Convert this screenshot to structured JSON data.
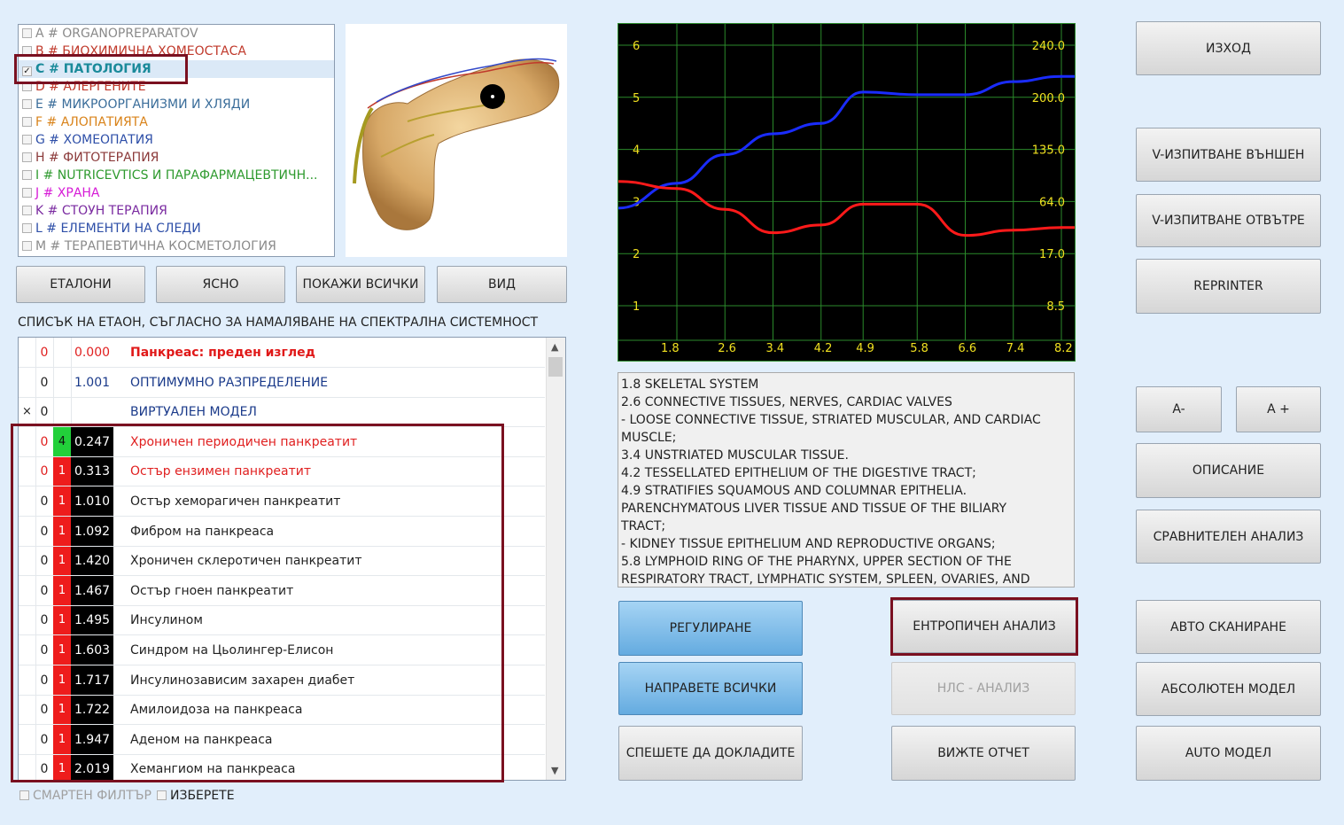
{
  "categories": [
    {
      "code": "A",
      "name": "ORGANOPREPARATOV",
      "color": "#8a8a8a",
      "checked": false
    },
    {
      "code": "B",
      "name": "БИОХИМИЧНА ХОМЕОСТАСА",
      "color": "#c0392b",
      "checked": false
    },
    {
      "code": "C",
      "name": "ПАТОЛОГИЯ",
      "color": "#1a8a9a",
      "checked": true
    },
    {
      "code": "D",
      "name": "АЛЕРГЕНИТЕ",
      "color": "#c0392b",
      "checked": false
    },
    {
      "code": "E",
      "name": "МИКРООРГАНИЗМИ И ХЛЯДИ",
      "color": "#3a6d9a",
      "checked": false
    },
    {
      "code": "F",
      "name": "АЛОПАТИЯТА",
      "color": "#d9831a",
      "checked": false
    },
    {
      "code": "G",
      "name": "ХОМЕОПАТИЯ",
      "color": "#2e4fa8",
      "checked": false
    },
    {
      "code": "H",
      "name": "ФИТОТЕРАПИЯ",
      "color": "#8b3a3a",
      "checked": false
    },
    {
      "code": "I",
      "name": "NUTRICEVTICS И ПАРАФАРМАЦЕВТИЧН...",
      "color": "#2e9a2e",
      "checked": false
    },
    {
      "code": "J",
      "name": "ХРАНА",
      "color": "#d61ad6",
      "checked": false
    },
    {
      "code": "K",
      "name": "СТОУН ТЕРАПИЯ",
      "color": "#7a2aa0",
      "checked": false
    },
    {
      "code": "L",
      "name": "ЕЛЕМЕНТИ НА СЛЕДИ",
      "color": "#2e4fa8",
      "checked": false
    },
    {
      "code": "M",
      "name": "ТЕРАПЕВТИЧНА КОСМЕТОЛОГИЯ",
      "color": "#8a8a8a",
      "checked": false
    }
  ],
  "toolbar": {
    "etaloni": "ЕТАЛОНИ",
    "clear": "ЯСНО",
    "show_all": "ПОКАЖИ ВСИЧКИ",
    "view": "ВИД"
  },
  "etalon_heading": "СПИСЪК НА ЕТАОН, СЪГЛАСНО ЗА НАМАЛЯВАНЕ НА СПЕКТРАЛНА СИСТЕМНОСТ",
  "etalons": [
    {
      "c0": "0",
      "c1": "",
      "c2": "",
      "value": "0.000",
      "name": "Панкреас: преден изглед",
      "style": "title"
    },
    {
      "c0": "0",
      "c1": "",
      "c2": "",
      "value": "1.001",
      "name": "ОПТИМУМНО РАЗПРЕДЕЛЕНИЕ",
      "style": "blue"
    },
    {
      "c0": "0",
      "c1": "",
      "c2": "",
      "value": "",
      "name": "ВИРТУАЛЕН МОДЕЛ",
      "style": "blue",
      "mark": "×"
    },
    {
      "c0": "0",
      "c1": "4",
      "c2": "",
      "value": "0.247",
      "name": "Хроничен периодичен панкреатит",
      "style": "red",
      "level": "green"
    },
    {
      "c0": "0",
      "c1": "1",
      "c2": "",
      "value": "0.313",
      "name": "Остър ензимен панкреатит",
      "style": "red",
      "level": "red"
    },
    {
      "c0": "0",
      "c1": "1",
      "c2": "",
      "value": "1.010",
      "name": "Остър хеморагичен панкреатит",
      "style": "normal",
      "level": "red"
    },
    {
      "c0": "0",
      "c1": "1",
      "c2": "",
      "value": "1.092",
      "name": "Фибром на панкреаса",
      "style": "normal",
      "level": "red"
    },
    {
      "c0": "0",
      "c1": "1",
      "c2": "",
      "value": "1.420",
      "name": "Хроничен склеротичен панкреатит",
      "style": "normal",
      "level": "red"
    },
    {
      "c0": "0",
      "c1": "1",
      "c2": "",
      "value": "1.467",
      "name": "Остър гноен панкреатит",
      "style": "normal",
      "level": "red"
    },
    {
      "c0": "0",
      "c1": "1",
      "c2": "",
      "value": "1.495",
      "name": "Инсулином",
      "style": "normal",
      "level": "red"
    },
    {
      "c0": "0",
      "c1": "1",
      "c2": "",
      "value": "1.603",
      "name": "Синдром на Цьолингер-Елисон",
      "style": "normal",
      "level": "red"
    },
    {
      "c0": "0",
      "c1": "1",
      "c2": "",
      "value": "1.717",
      "name": "Инсулинозависим захарен диабет",
      "style": "normal",
      "level": "red"
    },
    {
      "c0": "0",
      "c1": "1",
      "c2": "",
      "value": "1.722",
      "name": "Амилоидоза на панкреаса",
      "style": "normal",
      "level": "red"
    },
    {
      "c0": "0",
      "c1": "1",
      "c2": "",
      "value": "1.947",
      "name": "Аденом на панкреаса",
      "style": "normal",
      "level": "red"
    },
    {
      "c0": "0",
      "c1": "1",
      "c2": "",
      "value": "2.019",
      "name": "Хемангиом на панкреаса",
      "style": "normal",
      "level": "red"
    }
  ],
  "bottom": {
    "smart_filter": "СМАРТЕН ФИЛТЪР",
    "select": "ИЗБЕРЕТЕ"
  },
  "chart_data": {
    "type": "line",
    "x": [
      1.8,
      2.6,
      3.4,
      4.2,
      4.9,
      5.8,
      6.6,
      7.4,
      8.2
    ],
    "x_ticks": [
      "1.8",
      "2.6",
      "3.4",
      "4.2",
      "4.9",
      "5.8",
      "6.6",
      "7.4",
      "8.2"
    ],
    "y_left_ticks": [
      "6",
      "5",
      "4",
      "3",
      "2",
      "1"
    ],
    "y_right_ticks": [
      "240.0",
      "200.0",
      "135.0",
      "64.0",
      "17.0",
      "8.5"
    ],
    "ylim": [
      0.5,
      6.5
    ],
    "series": [
      {
        "color": "#1a2cff",
        "values": [
          3.35,
          3.9,
          4.3,
          4.5,
          5.1,
          5.05,
          5.05,
          5.3,
          5.4
        ]
      },
      {
        "color": "#ff1a1a",
        "values": [
          3.25,
          2.85,
          2.4,
          2.55,
          2.95,
          2.95,
          2.35,
          2.45,
          2.5
        ]
      }
    ],
    "colors": {
      "background": "#000000",
      "grid": "#2b8a2b",
      "ticks": "#f0e020"
    }
  },
  "description_lines": [
    "1.8 SKELETAL SYSTEM",
    "2.6 CONNECTIVE TISSUES, NERVES, CARDIAC VALVES",
    "- LOOSE CONNECTIVE TISSUE, STRIATED MUSCULAR, AND CARDIAC",
    "MUSCLE;",
    "3.4 UNSTRIATED MUSCULAR TISSUE.",
    "4.2 TESSELLATED EPITHELIUM OF THE DIGESTIVE TRACT;",
    "4.9 STRATIFIES SQUAMOUS AND COLUMNAR EPITHELIA.",
    "PARENCHYMATOUS LIVER TISSUE AND TISSUE OF THE BILIARY",
    "TRACT;",
    "- KIDNEY TISSUE EPITHELIUM AND REPRODUCTIVE ORGANS;",
    "5.8 LYMPHOID RING OF THE PHARYNX, UPPER SECTION OF THE",
    "RESPIRATORY TRACT, LYMPHATIC SYSTEM, SPLEEN, OVARIES, AND"
  ],
  "actions": {
    "regulate": "РЕГУЛИРАНЕ",
    "do_all": "НАПРАВЕТЕ ВСИЧКИ",
    "hurry_report": "СПЕШЕТЕ ДА ДОКЛАДИТЕ",
    "entropy": "ЕНТРОПИЧЕН АНАЛИЗ",
    "nls": "НЛС - АНАЛИЗ",
    "view_report": "ВИЖТЕ ОТЧЕТ"
  },
  "right": {
    "exit": "ИЗХОД",
    "v_ext": "V-ИЗПИТВАНЕ ВЪНШЕН",
    "v_int": "V-ИЗПИТВАНЕ ОТВЪТРЕ",
    "reprinter": "REPRINTER",
    "a_minus": "A-",
    "a_plus": "A +",
    "description": "ОПИСАНИЕ",
    "compare": "СРАВНИТЕЛЕН АНАЛИЗ",
    "auto_scan": "АВТО СКАНИРАНЕ",
    "abs_model": "АБСОЛЮТЕН МОДЕЛ",
    "auto_model": "AUTO МОДЕЛ"
  }
}
